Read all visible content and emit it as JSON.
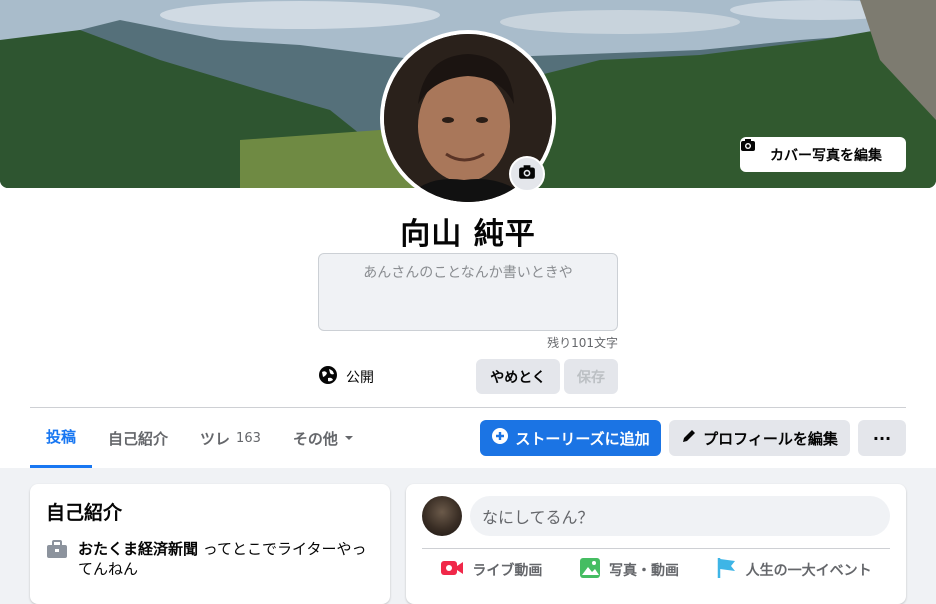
{
  "cover": {
    "edit_label": "カバー写真を編集"
  },
  "profile": {
    "name": "向山 純平"
  },
  "bio": {
    "placeholder": "あんさんのことなんか書いときや",
    "remaining": "残り101文字",
    "privacy_label": "公開",
    "cancel_label": "やめとく",
    "save_label": "保存"
  },
  "tabs": [
    {
      "label": "投稿",
      "count": "",
      "active": true
    },
    {
      "label": "自己紹介",
      "count": ""
    },
    {
      "label": "ツレ",
      "count": "163"
    },
    {
      "label": "その他",
      "count": ""
    }
  ],
  "actions": {
    "add_story": "ストーリーズに追加",
    "edit_profile": "プロフィールを編集",
    "more": "···"
  },
  "intro": {
    "title": "自己紹介",
    "work_bold": "おたくま経済新聞",
    "work_rest": "ってとこでライターやってんねん"
  },
  "composer": {
    "placeholder": "なにしてるん？",
    "live": "ライブ動画",
    "photo": "写真・動画",
    "life_event": "人生の一大イベント"
  },
  "colors": {
    "accent": "#1877f2",
    "live": "#f02849",
    "photo": "#45bd62",
    "event": "#3eb5e6"
  }
}
